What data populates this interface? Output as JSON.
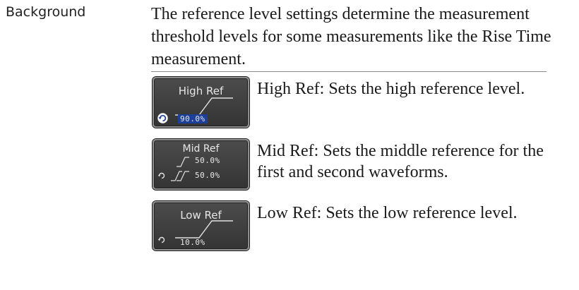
{
  "section_label": "Background",
  "intro_text": "The reference level settings determine the measurement threshold levels for some measurements like the Rise Time measurement.",
  "items": [
    {
      "key_title": "High Ref",
      "values": [
        "90.0%"
      ],
      "description": "High Ref: Sets the high reference level.",
      "icons": [
        "rotary-knob-icon",
        "rising-edge-icon"
      ]
    },
    {
      "key_title": "Mid Ref",
      "values": [
        "50.0%",
        "50.0%"
      ],
      "description": "Mid Ref: Sets the middle reference for the first and second waveforms.",
      "icons": [
        "rotary-knob-icon",
        "single-edge-icon",
        "double-edge-icon"
      ]
    },
    {
      "key_title": "Low Ref",
      "values": [
        "10.0%"
      ],
      "description": "Low Ref: Sets the low reference level.",
      "icons": [
        "rotary-knob-icon",
        "rising-edge-icon"
      ]
    }
  ],
  "colors": {
    "softkey_bg": "#404040",
    "softkey_border": "#8f8f8f",
    "highlight": "#1c3f9a",
    "key_text": "#e6e6e6"
  }
}
